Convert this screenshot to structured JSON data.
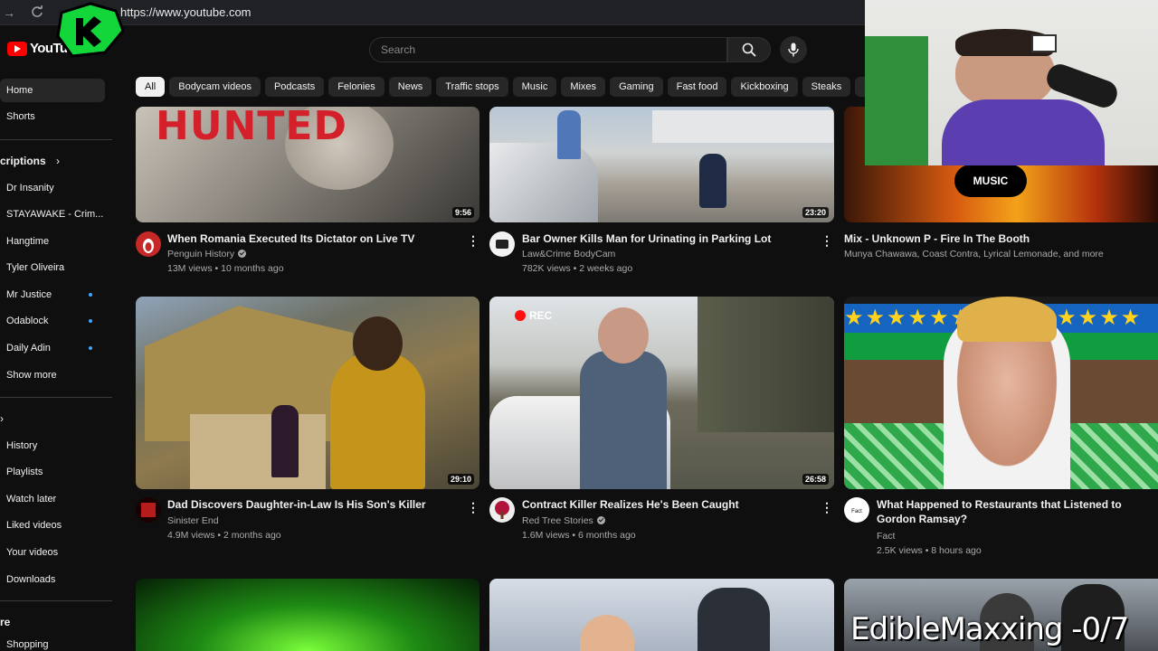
{
  "browser": {
    "url": "https://www.youtube.com"
  },
  "header": {
    "logo_text": "YouTube",
    "search_placeholder": "Search"
  },
  "chips": [
    "All",
    "Bodycam videos",
    "Podcasts",
    "Felonies",
    "News",
    "Traffic stops",
    "Music",
    "Mixes",
    "Gaming",
    "Fast food",
    "Kickboxing",
    "Steaks",
    "F"
  ],
  "sidebar": {
    "home": "Home",
    "shorts": "Shorts",
    "subscriptions_header": "criptions",
    "subscriptions": [
      {
        "label": "Dr Insanity",
        "dot": false
      },
      {
        "label": "STAYAWAKE - Crim...",
        "dot": false
      },
      {
        "label": "Hangtime",
        "dot": false
      },
      {
        "label": "Tyler Oliveira",
        "dot": false
      },
      {
        "label": "Mr Justice",
        "dot": true
      },
      {
        "label": "Odablock",
        "dot": true
      },
      {
        "label": "Daily Adin",
        "dot": true
      },
      {
        "label": "Show more",
        "dot": false
      }
    ],
    "you_items": [
      "History",
      "Playlists",
      "Watch later",
      "Liked videos",
      "Your videos",
      "Downloads"
    ],
    "explore_header": "re",
    "explore_items": [
      "Shopping"
    ]
  },
  "videos": [
    {
      "title": "When Romania Executed Its Dictator on Live TV",
      "channel": "Penguin History",
      "verified": true,
      "meta": "13M views • 10 months ago",
      "duration": "9:56",
      "thumb_text": "HUNTED"
    },
    {
      "title": "Bar Owner Kills Man for Urinating in Parking Lot",
      "channel": "Law&Crime BodyCam",
      "verified": false,
      "meta": "782K views • 2 weeks ago",
      "duration": "23:20"
    },
    {
      "title": "Mix - Unknown P - Fire In The Booth",
      "channel": "Munya Chawawa, Coast Contra, Lyrical Lemonade, and more",
      "verified": false,
      "meta": "",
      "duration": "",
      "thumb_text": "MUSIC"
    },
    {
      "title": "Dad Discovers Daughter-in-Law Is His Son's Killer",
      "channel": "Sinister End",
      "verified": false,
      "meta": "4.9M views • 2 months ago",
      "duration": "29:10"
    },
    {
      "title": "Contract Killer Realizes He's Been Caught",
      "channel": "Red Tree Stories",
      "verified": true,
      "meta": "1.6M views • 6 months ago",
      "duration": "26:58",
      "thumb_text": "REC"
    },
    {
      "title": "What Happened to Restaurants that Listened to Gordon Ramsay?",
      "channel": "Fact",
      "verified": false,
      "meta": "2.5K views • 8 hours ago",
      "duration": ""
    }
  ],
  "stream_overlay": {
    "text": "EdibleMaxxing -0/7"
  },
  "colors": {
    "brand": "#ff0000",
    "background": "#0f0f0f",
    "chip": "#272727",
    "dot": "#3ea6ff"
  },
  "icons": [
    "back-icon",
    "reload-icon",
    "search-icon",
    "mic-icon",
    "kebab-icon",
    "verified-icon",
    "chevron-right-icon"
  ]
}
